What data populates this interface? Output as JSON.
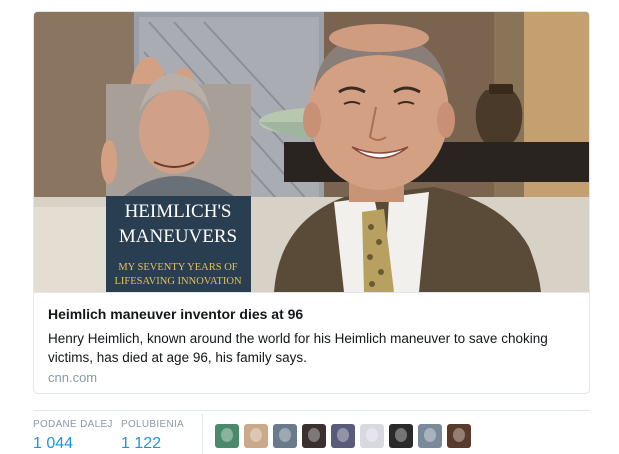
{
  "card": {
    "title": "Heimlich maneuver inventor dies at 96",
    "description": "Henry Heimlich, known around the world for his Heimlich maneuver to save choking victims, has died at age 96, his family says.",
    "domain": "cnn.com",
    "image": {
      "book_title_line1": "HEIMLICH'S",
      "book_title_line2": "MANEUVERS",
      "book_subtitle_line1": "MY SEVENTY YEARS OF",
      "book_subtitle_line2": "LIFESAVING INNOVATION"
    }
  },
  "stats": {
    "retweets_label": "PODANE DALEJ",
    "retweets_value": "1 044",
    "likes_label": "POLUBIENIA",
    "likes_value": "1 122"
  },
  "avatars": {
    "colors": [
      "#4a8a6a",
      "#c9a98a",
      "#6a7a8a",
      "#3a3030",
      "#5a5a7a",
      "#d8d8e0",
      "#2a2a2a",
      "#7a8a9a",
      "#5a3a2a"
    ]
  }
}
